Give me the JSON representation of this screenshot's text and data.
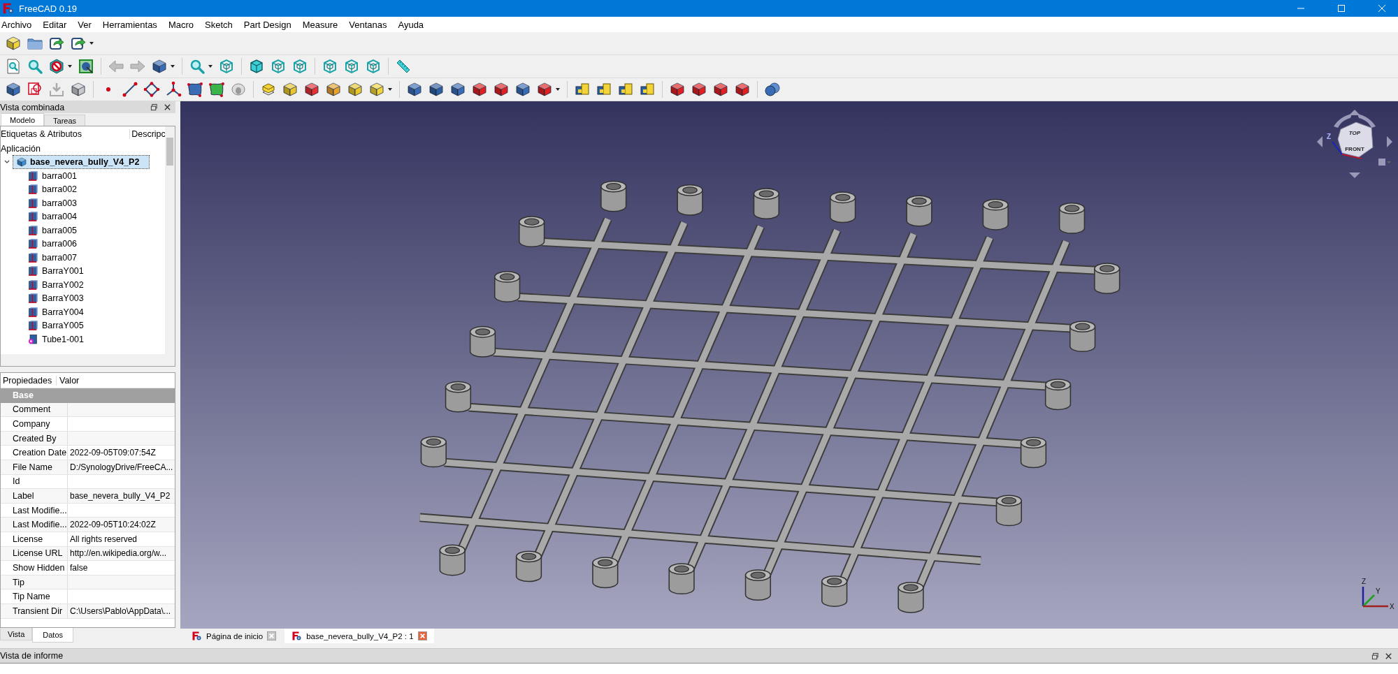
{
  "window": {
    "title": "FreeCAD 0.19"
  },
  "menu": [
    "Archivo",
    "Editar",
    "Ver",
    "Herramientas",
    "Macro",
    "Sketch",
    "Part Design",
    "Measure",
    "Ventanas",
    "Ayuda"
  ],
  "combo_view": {
    "title": "Vista combinada",
    "tabs": [
      {
        "label": "Modelo",
        "selected": true
      },
      {
        "label": "Tareas",
        "selected": false
      }
    ]
  },
  "tree": {
    "columns": [
      "Etiquetas & Atributos",
      "Descripc"
    ],
    "group": "Aplicación",
    "root": {
      "label": "base_nevera_bully_V4_P2",
      "selected": true,
      "expanded": true,
      "children": [
        {
          "label": "barra001",
          "kind": "body"
        },
        {
          "label": "barra002",
          "kind": "body"
        },
        {
          "label": "barra003",
          "kind": "body"
        },
        {
          "label": "barra004",
          "kind": "body"
        },
        {
          "label": "barra005",
          "kind": "body"
        },
        {
          "label": "barra006",
          "kind": "body"
        },
        {
          "label": "barra007",
          "kind": "body"
        },
        {
          "label": "BarraY001",
          "kind": "body"
        },
        {
          "label": "BarraY002",
          "kind": "body"
        },
        {
          "label": "BarraY003",
          "kind": "body"
        },
        {
          "label": "BarraY004",
          "kind": "body"
        },
        {
          "label": "BarraY005",
          "kind": "body"
        },
        {
          "label": "Tube1-001",
          "kind": "tube"
        }
      ]
    }
  },
  "properties": {
    "columns": [
      "Propiedades",
      "Valor"
    ],
    "group": "Base",
    "rows": [
      {
        "name": "Comment"
      },
      {
        "name": "Company"
      },
      {
        "name": "Created By"
      },
      {
        "name": "Creation Date",
        "value": "2022-09-05T09:07:54Z"
      },
      {
        "name": "File Name",
        "value": "D:/SynologyDrive/FreeCA..."
      },
      {
        "name": "Id"
      },
      {
        "name": "Label",
        "value": "base_nevera_bully_V4_P2"
      },
      {
        "name": "Last Modifie..."
      },
      {
        "name": "Last Modifie...",
        "value": "2022-09-05T10:24:02Z"
      },
      {
        "name": "License",
        "value": "All rights reserved"
      },
      {
        "name": "License URL",
        "value": "http://en.wikipedia.org/w..."
      },
      {
        "name": "Show Hidden",
        "value": "false"
      },
      {
        "name": "Tip"
      },
      {
        "name": "Tip Name"
      },
      {
        "name": "Transient Dir",
        "value": "C:\\Users\\Pablo\\AppData\\..."
      }
    ]
  },
  "panel_tabs": [
    {
      "label": "Vista",
      "selected": false
    },
    {
      "label": "Datos",
      "selected": true
    }
  ],
  "nav_cube": {
    "top": "TOP",
    "front": "FRONT",
    "axis": "Z"
  },
  "axes_labels": [
    "Z",
    "Y",
    "X"
  ],
  "document_tabs": [
    {
      "label": "Página de inicio",
      "selected": false
    },
    {
      "label": "base_nevera_bully_V4_P2 : 1",
      "selected": true
    }
  ],
  "report_view": {
    "title": "Vista de informe"
  }
}
